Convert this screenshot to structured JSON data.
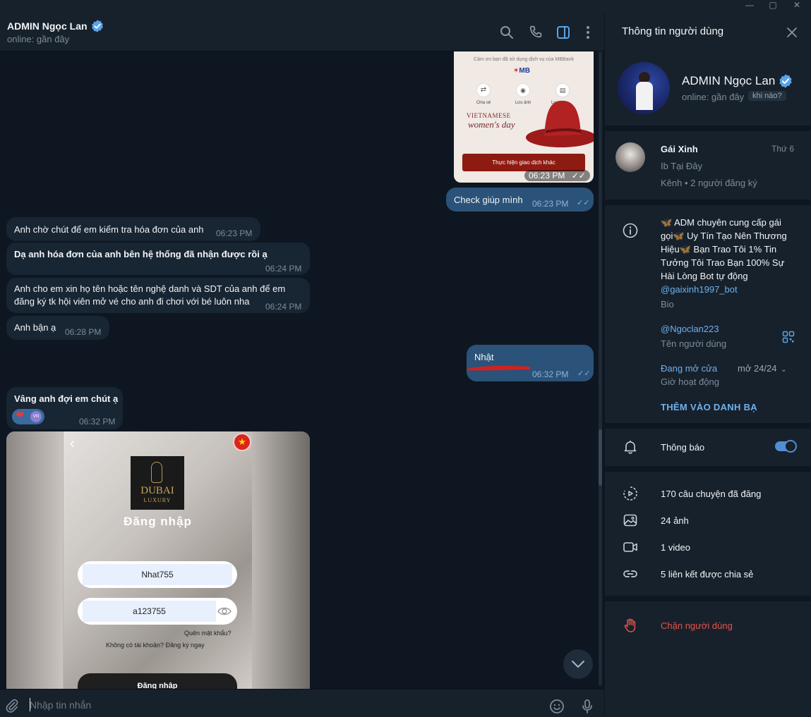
{
  "window": {
    "minimize": "—",
    "maximize": "▢",
    "close": "✕"
  },
  "header": {
    "title": "ADMIN Ngọc Lan",
    "status": "online: gần đây",
    "icons": [
      "search-icon",
      "phone-icon",
      "sidebar-toggle-icon",
      "more-icon"
    ]
  },
  "mb_image": {
    "thanks": "Cảm ơn bạn đã sử dụng dịch vụ của MBBank",
    "brand": "MB",
    "share": "Chia sẻ",
    "save": "Lưu ảnh",
    "save2": "Lư...",
    "heading1": "VIETNAMESE",
    "heading2": "women's day",
    "button": "Thực hiện giao dịch khác",
    "time": "06:23 PM"
  },
  "messages": [
    {
      "dir": "out",
      "text": "Check giúp mình",
      "time": "06:23 PM"
    },
    {
      "dir": "in",
      "text": "Anh chờ chút để em kiểm tra hóa đơn của anh",
      "time": "06:23 PM"
    },
    {
      "dir": "in",
      "text": "Dạ anh hóa đơn của anh bên hệ thống đã nhận được rồi ạ",
      "time": "06:24 PM"
    },
    {
      "dir": "in",
      "text_line1": "Anh cho em xin họ tên hoặc tên nghệ danh và SDT  của anh để em",
      "text_line2": "đăng ký tk hội viên mở vé cho anh đi chơi với bé luôn nha",
      "time": "06:24 PM"
    },
    {
      "dir": "in",
      "text": "Anh bận ạ",
      "time": "06:28 PM"
    },
    {
      "dir": "out",
      "text": "Nhật",
      "time": "06:32 PM"
    },
    {
      "dir": "in",
      "text": "Vâng anh đợi em chút ạ",
      "time": "06:32 PM",
      "reaction_badge": "VN"
    }
  ],
  "login_image": {
    "logo1": "DUBAI",
    "logo2": "LUXURY",
    "title": "Đăng nhập",
    "username": "Nhat755",
    "password": "a123755",
    "forgot": "Quên mật khẩu?",
    "no_account": "Không có tài khoản?  Đăng ký ngay",
    "login_button": "Đăng nhập"
  },
  "input": {
    "placeholder": "Nhập tin nhắn"
  },
  "side": {
    "title": "Thông tin người dùng",
    "name": "ADMIN Ngọc Lan",
    "status": "online: gần đây",
    "when_chip": "khi nào?",
    "channel": {
      "name": "Gái Xinh",
      "day": "Thứ 6",
      "desc": "Ib Tại Đây",
      "meta": "Kênh • 2 người đăng ký"
    },
    "bio_lines": [
      "🦋 ADM chuyên cung cấp gái",
      "gọi🦋 Uy Tín Tạo Nên Thương",
      "Hiệu🦋 Bạn Trao Tôi 1% Tin",
      "Tưởng Tôi Trao Bạn 100% Sự",
      "Hài Lòng Bot tự động"
    ],
    "bio_link": "@gaixinh1997_bot",
    "bio_label": "Bio",
    "username": "@Ngoclan223",
    "username_label": "Tên người dùng",
    "hours_status": "Đang mở cửa",
    "hours_value": "mở 24/24",
    "hours_label": "Giờ hoạt động",
    "add_contact": "THÊM VÀO DANH BẠ",
    "notifications": "Thông báo",
    "stories": "170 câu chuyện đã đăng",
    "photos": "24 ảnh",
    "videos": "1 video",
    "links": "5 liên kết được chia sẻ",
    "block": "Chặn người dùng"
  },
  "colors": {
    "accent": "#6fb1ee",
    "danger": "#e5534b",
    "out_bubble": "#2b5278",
    "in_bubble": "#182533"
  }
}
